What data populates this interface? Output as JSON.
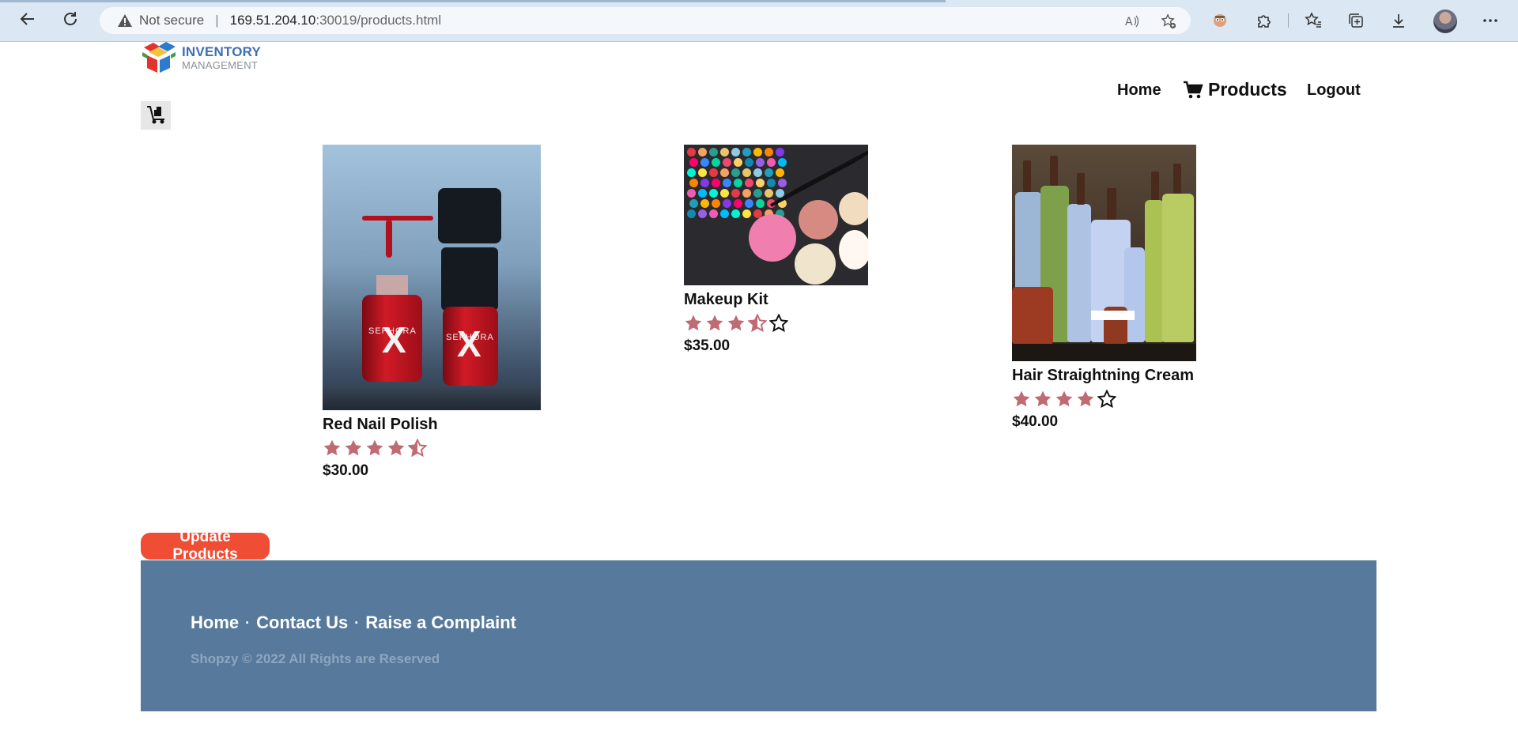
{
  "browser": {
    "security_label": "Not secure",
    "url_host": "169.51.204.10",
    "url_rest": ":30019/products.html"
  },
  "header": {
    "logo_title": "INVENTORY",
    "logo_subtitle": "MANAGEMENT",
    "nav": {
      "home": "Home",
      "products": "Products",
      "logout": "Logout"
    }
  },
  "products": [
    {
      "name": "Red Nail Polish",
      "rating": 4.5,
      "price": "$30.00"
    },
    {
      "name": "Makeup Kit",
      "rating": 3.5,
      "price": "$35.00"
    },
    {
      "name": "Hair Straightning Cream",
      "rating": 4,
      "price": "$40.00"
    }
  ],
  "actions": {
    "update_label": "Update Products"
  },
  "footer": {
    "links": [
      "Home",
      "Contact Us",
      "Raise a Complaint"
    ],
    "separator": "·",
    "copyright": "Shopzy © 2022 All Rights are Reserved"
  },
  "colors": {
    "star_filled": "#c06a73",
    "footer_bg": "#57799c",
    "update_button": "#f04d35",
    "logo_blue": "#3e6fb3"
  }
}
